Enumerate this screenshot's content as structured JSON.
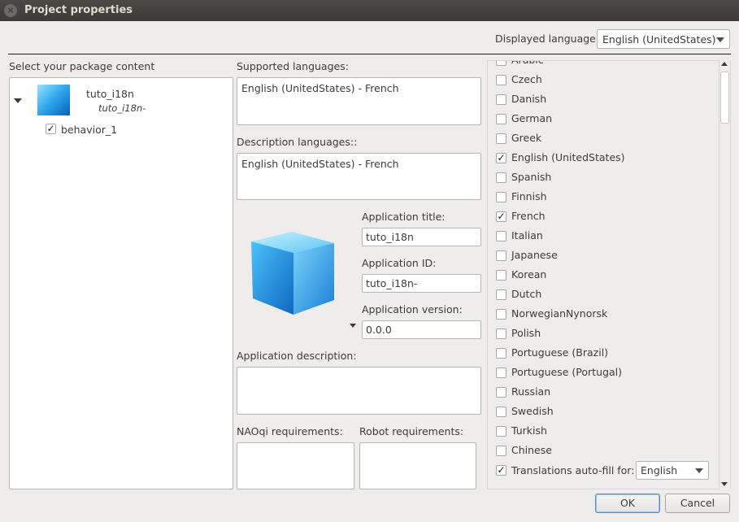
{
  "window": {
    "title": "Project properties",
    "close_glyph": "×"
  },
  "displayed_language": {
    "label": "Displayed language",
    "value": "English (UnitedStates)"
  },
  "package": {
    "header": "Select your package content",
    "root": {
      "name": "tuto_i18n",
      "id": "tuto_i18n-"
    },
    "children": [
      {
        "label": "behavior_1",
        "checked": true
      }
    ]
  },
  "supported_languages": {
    "label": "Supported languages:",
    "value": "English (UnitedStates) - French"
  },
  "description_languages": {
    "label": "Description languages::",
    "value": "English (UnitedStates) - French"
  },
  "app": {
    "title_label": "Application title:",
    "title_value": "tuto_i18n",
    "id_label": "Application ID:",
    "id_value": "tuto_i18n-",
    "version_label": "Application version:",
    "version_value": "0.0.0",
    "description_label": "Application description:",
    "naoqi_label": "NAOqi requirements:",
    "robot_label": "Robot requirements:"
  },
  "languages": [
    {
      "label": "Arabic",
      "checked": false
    },
    {
      "label": "Czech",
      "checked": false
    },
    {
      "label": "Danish",
      "checked": false
    },
    {
      "label": "German",
      "checked": false
    },
    {
      "label": "Greek",
      "checked": false
    },
    {
      "label": "English (UnitedStates)",
      "checked": true
    },
    {
      "label": "Spanish",
      "checked": false
    },
    {
      "label": "Finnish",
      "checked": false
    },
    {
      "label": "French",
      "checked": true
    },
    {
      "label": "Italian",
      "checked": false
    },
    {
      "label": "Japanese",
      "checked": false
    },
    {
      "label": "Korean",
      "checked": false
    },
    {
      "label": "Dutch",
      "checked": false
    },
    {
      "label": "NorwegianNynorsk",
      "checked": false
    },
    {
      "label": "Polish",
      "checked": false
    },
    {
      "label": "Portuguese (Brazil)",
      "checked": false
    },
    {
      "label": "Portuguese (Portugal)",
      "checked": false
    },
    {
      "label": "Russian",
      "checked": false
    },
    {
      "label": "Swedish",
      "checked": false
    },
    {
      "label": "Turkish",
      "checked": false
    },
    {
      "label": "Chinese",
      "checked": false
    }
  ],
  "autofill": {
    "label": "Translations auto-fill for:",
    "checked": true,
    "value": "English"
  },
  "buttons": {
    "ok": "OK",
    "cancel": "Cancel"
  },
  "check_glyph": "✓"
}
